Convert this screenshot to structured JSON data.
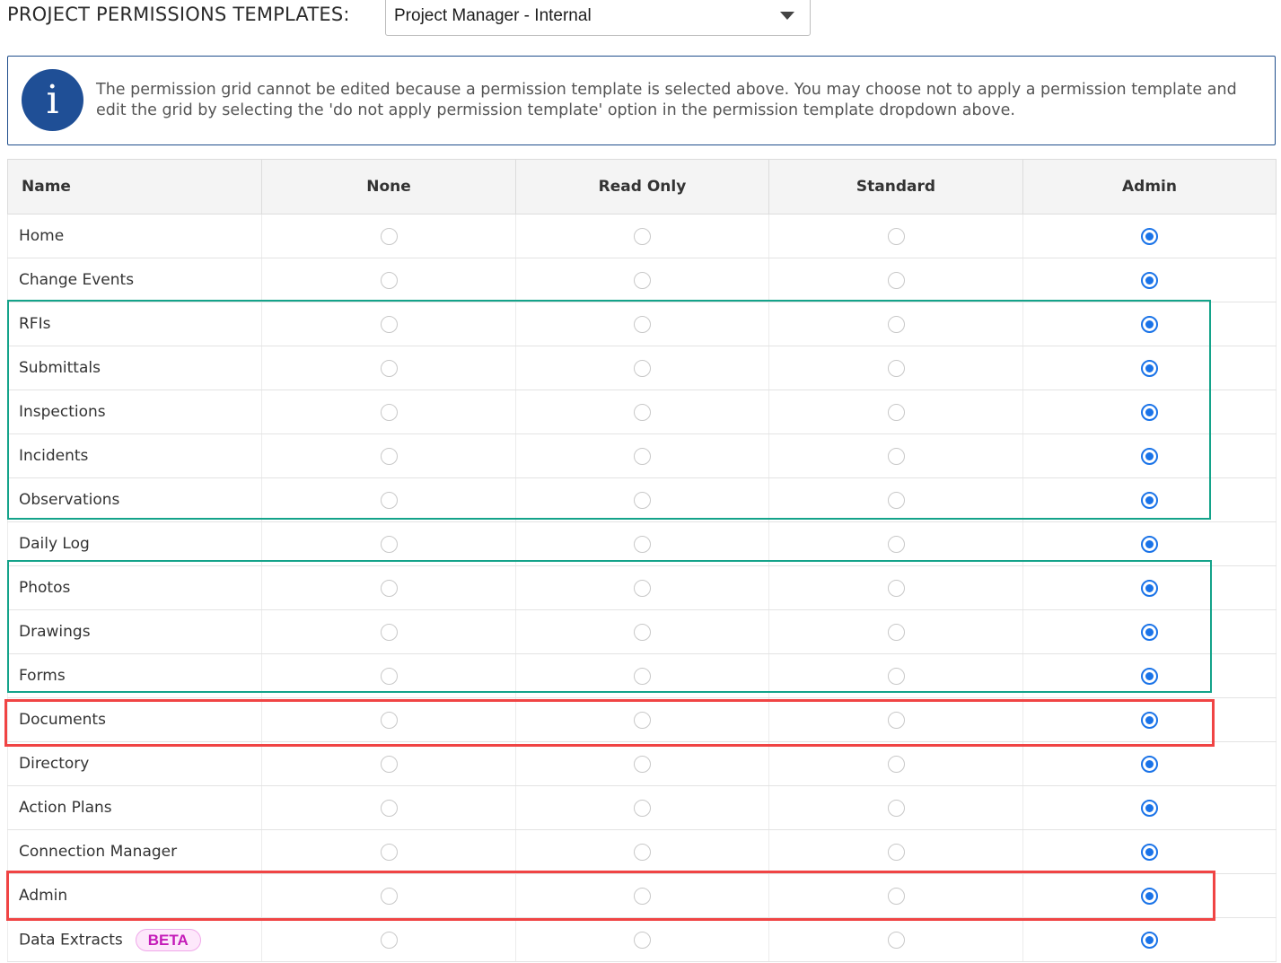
{
  "header": {
    "label": "PROJECT PERMISSIONS TEMPLATES:",
    "template_select": {
      "value": "Project Manager - Internal"
    }
  },
  "info": {
    "icon": "info-icon",
    "message": "The permission grid cannot be edited because a permission template is selected above. You may choose not to apply a permission template and edit the grid by selecting the 'do not apply permission template' option in the permission template dropdown above."
  },
  "grid": {
    "columns": [
      "Name",
      "None",
      "Read Only",
      "Standard",
      "Admin"
    ],
    "rows": [
      {
        "name": "Home",
        "selected": "Admin"
      },
      {
        "name": "Change Events",
        "selected": "Admin"
      },
      {
        "name": "RFIs",
        "selected": "Admin"
      },
      {
        "name": "Submittals",
        "selected": "Admin"
      },
      {
        "name": "Inspections",
        "selected": "Admin"
      },
      {
        "name": "Incidents",
        "selected": "Admin"
      },
      {
        "name": "Observations",
        "selected": "Admin"
      },
      {
        "name": "Daily Log",
        "selected": "Admin"
      },
      {
        "name": "Photos",
        "selected": "Admin"
      },
      {
        "name": "Drawings",
        "selected": "Admin"
      },
      {
        "name": "Forms",
        "selected": "Admin"
      },
      {
        "name": "Documents",
        "selected": "Admin"
      },
      {
        "name": "Directory",
        "selected": "Admin"
      },
      {
        "name": "Action Plans",
        "selected": "Admin"
      },
      {
        "name": "Connection Manager",
        "selected": "Admin"
      },
      {
        "name": "Admin",
        "selected": "Admin"
      },
      {
        "name": "Data Extracts",
        "selected": "Admin",
        "badge": "BETA"
      }
    ]
  },
  "colors": {
    "selected_radio": "#1a73e8",
    "info_icon_bg": "#1f4f96",
    "highlight_teal": "#14a38a",
    "highlight_red": "#f04444",
    "beta_text": "#c41bb8"
  }
}
